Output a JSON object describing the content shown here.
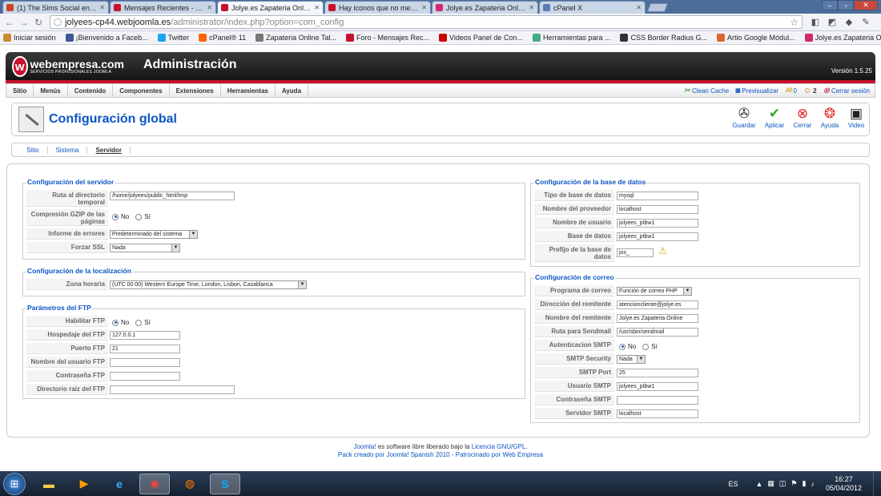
{
  "browser": {
    "tabs": [
      {
        "title": "(1) The Sims Social en Faceb",
        "fav_color": "#c42"
      },
      {
        "title": "Mensajes Recientes - webe",
        "fav_color": "#c8112c"
      },
      {
        "title": "Jolye.es Zapateria Online X",
        "fav_color": "#c8112c"
      },
      {
        "title": "Hay iconos que no me sale",
        "fav_color": "#c8112c"
      },
      {
        "title": "Jolye.es Zapateria Online X",
        "fav_color": "#d2286e"
      },
      {
        "title": "cPanel X",
        "fav_color": "#5a7cb3"
      }
    ],
    "active_tab": 2,
    "url_host": "jolyees-cp44.webjoomla.es",
    "url_path": "/administrator/index.php?option=com_config",
    "bookmarks": [
      {
        "label": "Iniciar sesión",
        "icon": "google-icon",
        "color": "#c83"
      },
      {
        "label": "¡Bienvenido a Faceb...",
        "icon": "facebook-icon",
        "color": "#3b5998"
      },
      {
        "label": "Twitter",
        "icon": "twitter-icon",
        "color": "#1da1f2"
      },
      {
        "label": "cPanel® 11",
        "icon": "cpanel-icon",
        "color": "#f60"
      },
      {
        "label": "Zapateria Online Tal...",
        "icon": "page-icon",
        "color": "#777"
      },
      {
        "label": "Foro - Mensajes Rec...",
        "icon": "webempresa-icon",
        "color": "#c8112c"
      },
      {
        "label": "Videos Panel de Con...",
        "icon": "youtube-icon",
        "color": "#c00"
      },
      {
        "label": "Herramientas para ...",
        "icon": "tools-icon",
        "color": "#4a8"
      },
      {
        "label": "CSS Border Radius G...",
        "icon": "css-icon",
        "color": "#333"
      },
      {
        "label": "Artio Google Módul...",
        "icon": "artio-icon",
        "color": "#d63"
      },
      {
        "label": "Jolye.es Zapateria O...",
        "icon": "joomla-icon",
        "color": "#d2286e"
      }
    ]
  },
  "header": {
    "brand": "webempresa.com",
    "brand_tagline": "SERVICIOS PROFESIONALES JOOMLA",
    "title": "Administración",
    "version": "Versión 1.5.25"
  },
  "menu": {
    "items": [
      "Sitio",
      "Menús",
      "Contenido",
      "Componentes",
      "Extensiones",
      "Herramientas",
      "Ayuda"
    ],
    "clean_cache": "Clean Cache",
    "preview": "Previsualizar",
    "messages": "0",
    "users": "2",
    "logout": "Cerrar sesión"
  },
  "titlebar": {
    "title": "Configuración global",
    "buttons": [
      "Guardar",
      "Aplicar",
      "Cerrar",
      "Ayuda",
      "Video"
    ]
  },
  "subtabs": [
    "Sitio",
    "Sistema",
    "Servidor"
  ],
  "server": {
    "legend": "Configuración del servidor",
    "temp_label": "Ruta al directorio temporal",
    "temp_value": "/home/jolyees/public_html/tmp",
    "gzip_label": "Compresión GZIP de las páginas",
    "no": "No",
    "si": "Sí",
    "errors_label": "Informe de errores",
    "errors_value": "Predeterminado del sistema",
    "ssl_label": "Forzar SSL",
    "ssl_value": "Nada"
  },
  "locale": {
    "legend": "Configuración de la localización",
    "tz_label": "Zona horaria",
    "tz_value": "(UTC 00:00) Western Europe Time, London, Lisbon, Casablanca"
  },
  "ftp": {
    "legend": "Parámetros del FTP",
    "enable_label": "Habilitar FTP",
    "host_label": "Hospedaje del FTP",
    "host_value": "127.0.0.1",
    "port_label": "Puerto FTP",
    "port_value": "21",
    "user_label": "Nombre del usuario FTP",
    "user_value": "",
    "pass_label": "Contraseña FTP",
    "pass_value": "",
    "root_label": "Directorio raíz del FTP",
    "root_value": ""
  },
  "db": {
    "legend": "Configuración de la base de datos",
    "type_label": "Tipo de base de datos",
    "type_value": "mysql",
    "host_label": "Nombre del proveedor",
    "host_value": "localhost",
    "user_label": "Nombre de usuario",
    "user_value": "jolyees_ptbw1",
    "name_label": "Base de datos",
    "name_value": "jolyees_ptbw1",
    "prefix_label": "Prefijo de la base de datos",
    "prefix_value": "jos_"
  },
  "mail": {
    "legend": "Configuración de correo",
    "mailer_label": "Programa de correo",
    "mailer_value": "Función de correo PHP",
    "from_label": "Dirección del remitente",
    "from_value": "atencioncliente@jolye.es",
    "fromname_label": "Nombre del remitente",
    "fromname_value": "Jolye.es Zapateria Online",
    "sendmail_label": "Ruta para Sendmail",
    "sendmail_value": "/usr/sbin/sendmail",
    "smtpauth_label": "Autenticacion SMTP",
    "smtpsec_label": "SMTP Security",
    "smtpsec_value": "Nada",
    "smtpport_label": "SMTP Port",
    "smtpport_value": "25",
    "smtpuser_label": "Usuario SMTP",
    "smtpuser_value": "jolyees_ptbw1",
    "smtppass_label": "Contraseña SMTP",
    "smtppass_value": "",
    "smtphost_label": "Servidor SMTP",
    "smtphost_value": "localhost"
  },
  "footer": {
    "joomla": "Joomla!",
    "line1_mid": " es software libre liberado bajo la ",
    "license": "Licencia GNU/GPL",
    "line1_end": ".",
    "line2_start": "Pack creado por ",
    "line2_link1": "Joomla! Spanish 2010",
    "line2_mid": " - Patrocinado por ",
    "line2_link2": "Web Empresa"
  },
  "taskbar": {
    "lang": "ES",
    "time": "16:27",
    "date": "05/04/2012"
  }
}
